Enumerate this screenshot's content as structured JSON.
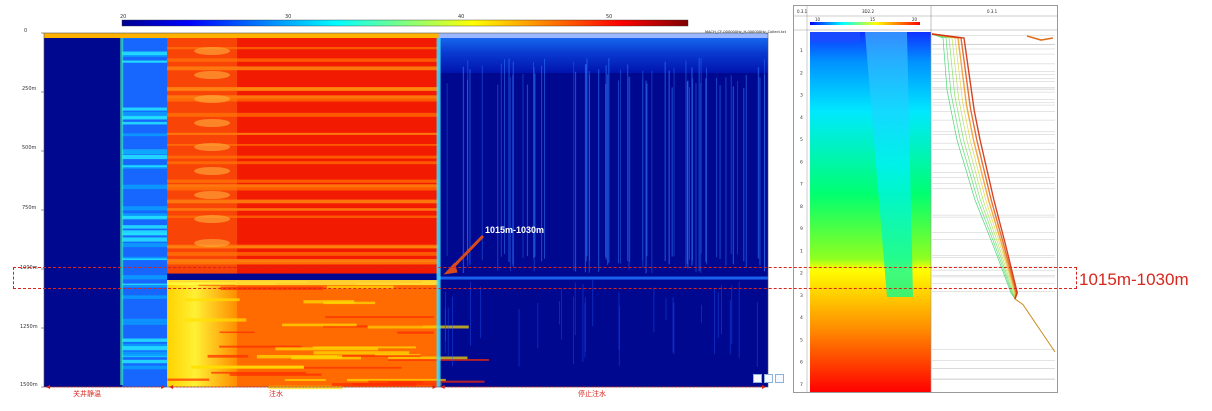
{
  "chart_data": [
    {
      "type": "heatmap",
      "colorbar_ticks": [
        "20",
        "30",
        "40",
        "50"
      ],
      "colorbar_range": [
        15,
        60
      ],
      "colormap": [
        "#00008f",
        "#0000ff",
        "#00ffff",
        "#ffff00",
        "#ff0000",
        "#800000"
      ],
      "y_ticks": [
        "0",
        "250m",
        "500m",
        "750m",
        "1000m",
        "1250m",
        "1500m"
      ],
      "depth_range": [
        0,
        1500
      ],
      "top_legend_text": "MACH_CF-000000Hz_H-000000Hz_Collect.txt",
      "phases": [
        {
          "label": "关井静温",
          "start": 0.0,
          "end": 0.17
        },
        {
          "label": "注水",
          "start": 0.17,
          "end": 0.545
        },
        {
          "label": "停止注水",
          "start": 0.545,
          "end": 1.0
        }
      ],
      "injection_zone_depth": [
        1015,
        1030
      ],
      "annotation_text": "1015m-1030m"
    },
    {
      "type": "line",
      "panel_headers": [
        "0.3.1",
        "3D2.2",
        "0.3.1"
      ],
      "top_ticks": [
        "10",
        "15",
        "20"
      ],
      "depth_ticks": [
        "1",
        "2",
        "3",
        "4",
        "5",
        "6",
        "7",
        "8",
        "9",
        "1",
        "2",
        "3",
        "4",
        "5",
        "6",
        "7"
      ],
      "zone_depth": [
        1015,
        1030
      ]
    }
  ],
  "zone_label": "1015m-1030m",
  "toolbar_icons": [
    "fit-icon",
    "settings-icon",
    "zoom-icon",
    "save-icon"
  ],
  "colors": {
    "zone": "#d7261e",
    "arrow": "#d84a1b",
    "grid": "#cccccc"
  }
}
